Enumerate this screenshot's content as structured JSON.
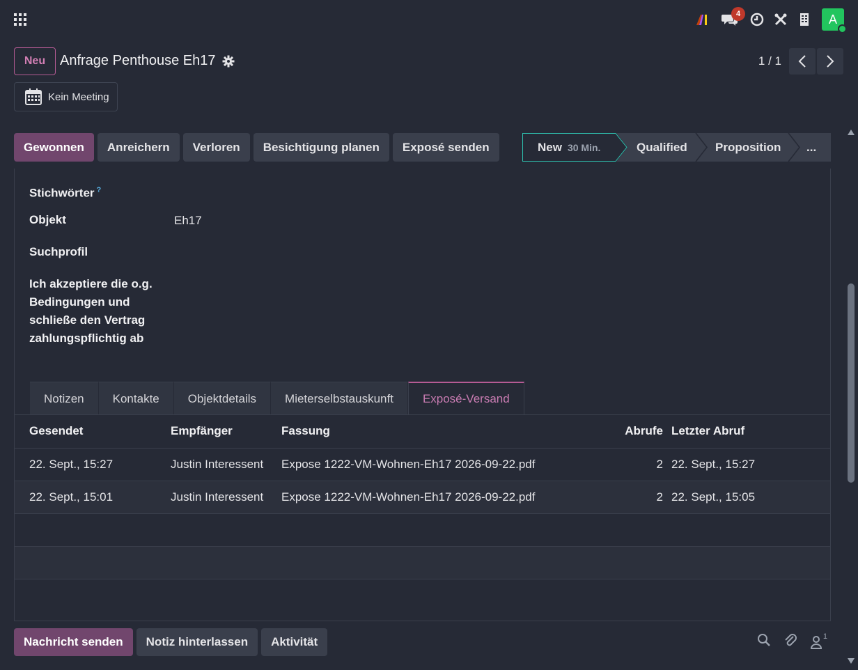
{
  "navbar": {
    "icons": [
      "apps-grid-icon",
      "ai-logo-icon",
      "chat-icon",
      "clock-icon",
      "tools-icon",
      "building-icon"
    ],
    "chat_badge": "4",
    "avatar_letter": "A"
  },
  "control": {
    "new_label": "Neu",
    "title": "Anfrage Penthouse Eh17",
    "pager": "1 / 1",
    "meeting_label": "Kein Meeting"
  },
  "actions": [
    "Gewonnen",
    "Anreichern",
    "Verloren",
    "Besichtigung planen",
    "Exposé senden"
  ],
  "stages": {
    "current": "New",
    "current_sub": "30 Min.",
    "items": [
      "Qualified",
      "Proposition",
      "..."
    ]
  },
  "fields": {
    "stichwoerter_label": "Stichwörter",
    "help_mark": "?",
    "objekt_label": "Objekt",
    "objekt_value": "Eh17",
    "suchprofil_label": "Suchprofil",
    "consent_line1": "Ich akzeptiere die o.g.",
    "consent_line2": "Bedingungen und",
    "consent_line3": "schließe den Vertrag",
    "consent_line4": "zahlungspflichtig ab"
  },
  "tabs": [
    "Notizen",
    "Kontakte",
    "Objektdetails",
    "Mieterselbstauskunft",
    "Exposé-Versand"
  ],
  "table": {
    "headers": [
      "Gesendet",
      "Empfänger",
      "Fassung",
      "Abrufe",
      "Letzter Abruf"
    ],
    "rows": [
      [
        "22. Sept., 15:27",
        "Justin Interessent",
        "Expose 1222-VM-Wohnen-Eh17 2026-09-22.pdf",
        "2",
        "22. Sept., 15:27"
      ],
      [
        "22. Sept., 15:01",
        "Justin Interessent",
        "Expose 1222-VM-Wohnen-Eh17 2026-09-22.pdf",
        "2",
        "22. Sept., 15:05"
      ]
    ]
  },
  "chatter": {
    "send_message": "Nachricht senden",
    "log_note": "Notiz hinterlassen",
    "activity": "Aktivität",
    "followers_count": "1"
  },
  "colors": {
    "primary": "#71466d",
    "accent_pink": "#b55b94",
    "stage_teal": "#2ec2b0",
    "badge_red": "#c0392b",
    "avatar_green": "#22c55e"
  }
}
